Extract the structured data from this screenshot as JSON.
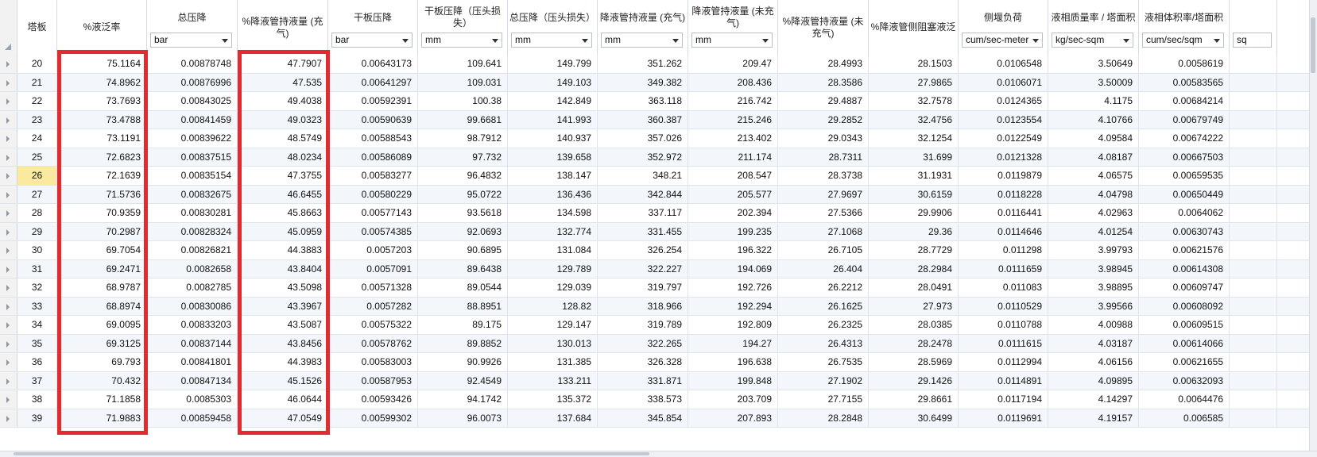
{
  "columns": [
    {
      "id": "stage",
      "title": "塔板",
      "unit": null
    },
    {
      "id": "flood",
      "title": "%液泛率",
      "unit": null
    },
    {
      "id": "total_dp",
      "title": "总压降",
      "unit": "bar"
    },
    {
      "id": "dc_holdup_aerated",
      "title": "%降液管持液量 (充气)",
      "unit": null
    },
    {
      "id": "dry_dp",
      "title": "干板压降",
      "unit": "bar"
    },
    {
      "id": "dry_dp_head",
      "title": "干板压降（压头损失）",
      "unit": "mm"
    },
    {
      "id": "total_dp_head",
      "title": "总压降（压头损失）",
      "unit": "mm"
    },
    {
      "id": "dc_holdup_aerated_mm",
      "title": "降液管持液量 (充气)",
      "unit": "mm"
    },
    {
      "id": "dc_holdup_unaerated_mm",
      "title": "降液管持液量 (未充气)",
      "unit": "mm"
    },
    {
      "id": "dc_holdup_unaerated_pct",
      "title": "%降液管持液量 (未充气)",
      "unit": null
    },
    {
      "id": "dc_choke_flood",
      "title": "%降液管侧阻塞液泛",
      "unit": null
    },
    {
      "id": "weir_load",
      "title": "侧堰负荷",
      "unit": "cum/sec-meter"
    },
    {
      "id": "liq_mass_rate",
      "title": "液相质量率 / 塔面积",
      "unit": "kg/sec-sqm"
    },
    {
      "id": "liq_vol_rate",
      "title": "液相体积率/塔面积",
      "unit": "cum/sec/sqm"
    },
    {
      "id": "partial",
      "title": "",
      "unit": "sq"
    }
  ],
  "rows": [
    [
      "20",
      "75.1164",
      "0.00878748",
      "47.7907",
      "0.00643173",
      "109.641",
      "149.799",
      "351.262",
      "209.47",
      "28.4993",
      "28.1503",
      "0.0106548",
      "3.50649",
      "0.0058619",
      ""
    ],
    [
      "21",
      "74.8962",
      "0.00876996",
      "47.535",
      "0.00641297",
      "109.031",
      "149.103",
      "349.382",
      "208.436",
      "28.3586",
      "27.9865",
      "0.0106071",
      "3.50009",
      "0.00583565",
      ""
    ],
    [
      "22",
      "73.7693",
      "0.00843025",
      "49.4038",
      "0.00592391",
      "100.38",
      "142.849",
      "363.118",
      "216.742",
      "29.4887",
      "32.7578",
      "0.0124365",
      "4.1175",
      "0.00684214",
      ""
    ],
    [
      "23",
      "73.4788",
      "0.00841459",
      "49.0323",
      "0.00590639",
      "99.6681",
      "141.993",
      "360.387",
      "215.246",
      "29.2852",
      "32.4756",
      "0.0123554",
      "4.10766",
      "0.00679749",
      ""
    ],
    [
      "24",
      "73.1191",
      "0.00839622",
      "48.5749",
      "0.00588543",
      "98.7912",
      "140.937",
      "357.026",
      "213.402",
      "29.0343",
      "32.1254",
      "0.0122549",
      "4.09584",
      "0.00674222",
      ""
    ],
    [
      "25",
      "72.6823",
      "0.00837515",
      "48.0234",
      "0.00586089",
      "97.732",
      "139.658",
      "352.972",
      "211.174",
      "28.7311",
      "31.699",
      "0.0121328",
      "4.08187",
      "0.00667503",
      ""
    ],
    [
      "26",
      "72.1639",
      "0.00835154",
      "47.3755",
      "0.00583277",
      "96.4832",
      "138.147",
      "348.21",
      "208.547",
      "28.3738",
      "31.1931",
      "0.0119879",
      "4.06575",
      "0.00659535",
      ""
    ],
    [
      "27",
      "71.5736",
      "0.00832675",
      "46.6455",
      "0.00580229",
      "95.0722",
      "136.436",
      "342.844",
      "205.577",
      "27.9697",
      "30.6159",
      "0.0118228",
      "4.04798",
      "0.00650449",
      ""
    ],
    [
      "28",
      "70.9359",
      "0.00830281",
      "45.8663",
      "0.00577143",
      "93.5618",
      "134.598",
      "337.117",
      "202.394",
      "27.5366",
      "29.9906",
      "0.0116441",
      "4.02963",
      "0.0064062",
      ""
    ],
    [
      "29",
      "70.2987",
      "0.00828324",
      "45.0959",
      "0.00574385",
      "92.0693",
      "132.774",
      "331.455",
      "199.235",
      "27.1068",
      "29.36",
      "0.0114646",
      "4.01254",
      "0.00630743",
      ""
    ],
    [
      "30",
      "69.7054",
      "0.00826821",
      "44.3883",
      "0.0057203",
      "90.6895",
      "131.084",
      "326.254",
      "196.322",
      "26.7105",
      "28.7729",
      "0.011298",
      "3.99793",
      "0.00621576",
      ""
    ],
    [
      "31",
      "69.2471",
      "0.0082658",
      "43.8404",
      "0.0057091",
      "89.6438",
      "129.789",
      "322.227",
      "194.069",
      "26.404",
      "28.2984",
      "0.0111659",
      "3.98945",
      "0.00614308",
      ""
    ],
    [
      "32",
      "68.9787",
      "0.0082785",
      "43.5098",
      "0.00571328",
      "89.0544",
      "129.039",
      "319.797",
      "192.726",
      "26.2212",
      "28.0491",
      "0.011083",
      "3.98895",
      "0.00609747",
      ""
    ],
    [
      "33",
      "68.8974",
      "0.00830086",
      "43.3967",
      "0.0057282",
      "88.8951",
      "128.82",
      "318.966",
      "192.294",
      "26.1625",
      "27.973",
      "0.0110529",
      "3.99566",
      "0.00608092",
      ""
    ],
    [
      "34",
      "69.0095",
      "0.00833203",
      "43.5087",
      "0.00575322",
      "89.175",
      "129.147",
      "319.789",
      "192.809",
      "26.2325",
      "28.0385",
      "0.0110788",
      "4.00988",
      "0.00609515",
      ""
    ],
    [
      "35",
      "69.3125",
      "0.00837144",
      "43.8456",
      "0.00578762",
      "89.8852",
      "130.013",
      "322.265",
      "194.27",
      "26.4313",
      "28.2478",
      "0.0111615",
      "4.03187",
      "0.00614066",
      ""
    ],
    [
      "36",
      "69.793",
      "0.00841801",
      "44.3983",
      "0.00583003",
      "90.9926",
      "131.385",
      "326.328",
      "196.638",
      "26.7535",
      "28.5969",
      "0.0112994",
      "4.06156",
      "0.00621655",
      ""
    ],
    [
      "37",
      "70.432",
      "0.00847134",
      "45.1526",
      "0.00587953",
      "92.4549",
      "133.211",
      "331.871",
      "199.848",
      "27.1902",
      "29.1426",
      "0.0114891",
      "4.09895",
      "0.00632093",
      ""
    ],
    [
      "38",
      "71.1858",
      "0.0085303",
      "46.0644",
      "0.00593426",
      "94.1742",
      "135.372",
      "338.573",
      "203.709",
      "27.7155",
      "29.8661",
      "0.0117194",
      "4.14297",
      "0.0064476",
      ""
    ],
    [
      "39",
      "71.9883",
      "0.00859458",
      "47.0549",
      "0.00599302",
      "96.0073",
      "137.684",
      "345.854",
      "207.893",
      "28.2848",
      "30.6499",
      "0.0119691",
      "4.19157",
      "0.006585",
      ""
    ]
  ],
  "selected_stage": "26",
  "highlight_color": "#e32a2f",
  "selection_color": "#fbe9a0"
}
